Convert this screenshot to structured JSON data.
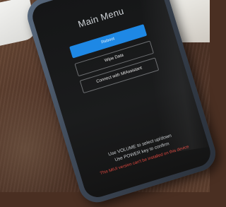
{
  "screen": {
    "title": "Main Menu",
    "buttons": [
      {
        "label": "Reboot",
        "style": "primary"
      },
      {
        "label": "Wipe Data",
        "style": "outline"
      },
      {
        "label": "Connect with MIAssistant",
        "style": "outline"
      }
    ],
    "instructions": [
      "Use VOLUME to select up/down",
      "Use POWER key to confirm"
    ],
    "warning": "This MIUI version can't be installed on this device"
  },
  "colors": {
    "primary_button": "#1e88e5",
    "warning_text": "#e0473f"
  }
}
